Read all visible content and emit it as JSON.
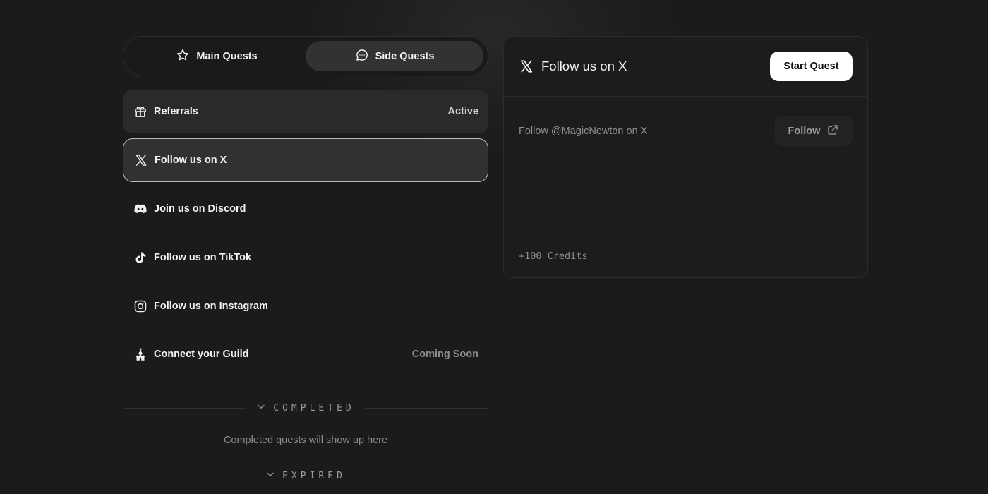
{
  "tabs": {
    "main": {
      "label": "Main Quests",
      "icon": "star-icon"
    },
    "side": {
      "label": "Side Quests",
      "icon": "chat-bubble-icon",
      "active": true
    }
  },
  "quests": [
    {
      "label": "Referrals",
      "status": "Active",
      "icon": "gift-icon"
    },
    {
      "label": "Follow us on X",
      "status": "",
      "icon": "x-logo-icon",
      "selected": true
    },
    {
      "label": "Join us on Discord",
      "status": "",
      "icon": "discord-icon"
    },
    {
      "label": "Follow us on TikTok",
      "status": "",
      "icon": "tiktok-icon"
    },
    {
      "label": "Follow us on Instagram",
      "status": "",
      "icon": "instagram-icon"
    },
    {
      "label": "Connect your Guild",
      "status": "Coming Soon",
      "icon": "castle-icon"
    }
  ],
  "sections": {
    "completed": {
      "label": "COMPLETED",
      "empty_text": "Completed quests will show up here"
    },
    "expired": {
      "label": "EXPIRED"
    }
  },
  "detail": {
    "title": "Follow us on X",
    "start_button": "Start Quest",
    "task_text": "Follow @MagicNewton on X",
    "follow_button": "Follow",
    "reward": "+100 Credits"
  },
  "colors": {
    "background": "#1b1b1b",
    "card": "#2a2a2a",
    "selected_border": "#bdbdbd",
    "accent_button": "#ffffff"
  }
}
